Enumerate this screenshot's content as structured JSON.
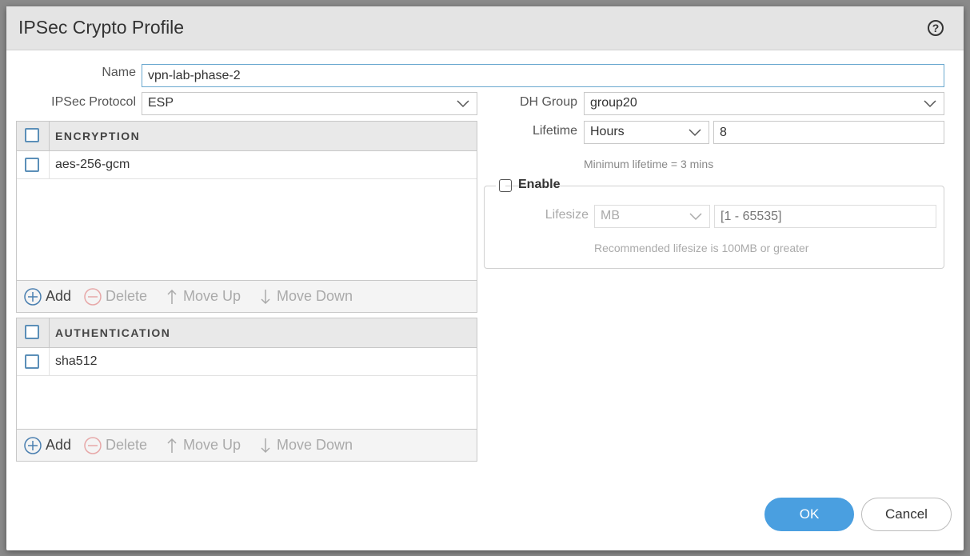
{
  "dialog": {
    "title": "IPSec Crypto Profile",
    "help_glyph": "?"
  },
  "form": {
    "name_label": "Name",
    "name_value": "vpn-lab-phase-2",
    "protocol_label": "IPSec Protocol",
    "protocol_value": "ESP",
    "dh_label": "DH Group",
    "dh_value": "group20",
    "lifetime_label": "Lifetime",
    "lifetime_unit": "Hours",
    "lifetime_value": "8",
    "lifetime_hint": "Minimum lifetime = 3 mins",
    "enable_label": "Enable",
    "lifesize_label": "Lifesize",
    "lifesize_unit": "MB",
    "lifesize_placeholder": "[1 - 65535]",
    "lifesize_hint": "Recommended lifesize is 100MB or greater"
  },
  "encryption": {
    "header": "ENCRYPTION",
    "rows": [
      "aes-256-gcm"
    ]
  },
  "authentication": {
    "header": "AUTHENTICATION",
    "rows": [
      "sha512"
    ]
  },
  "toolbar": {
    "add": "Add",
    "delete": "Delete",
    "move_up": "Move Up",
    "move_down": "Move Down"
  },
  "buttons": {
    "ok": "OK",
    "cancel": "Cancel"
  },
  "colors": {
    "accent": "#4a9fe0",
    "checkbox_border": "#5b8fb8"
  }
}
